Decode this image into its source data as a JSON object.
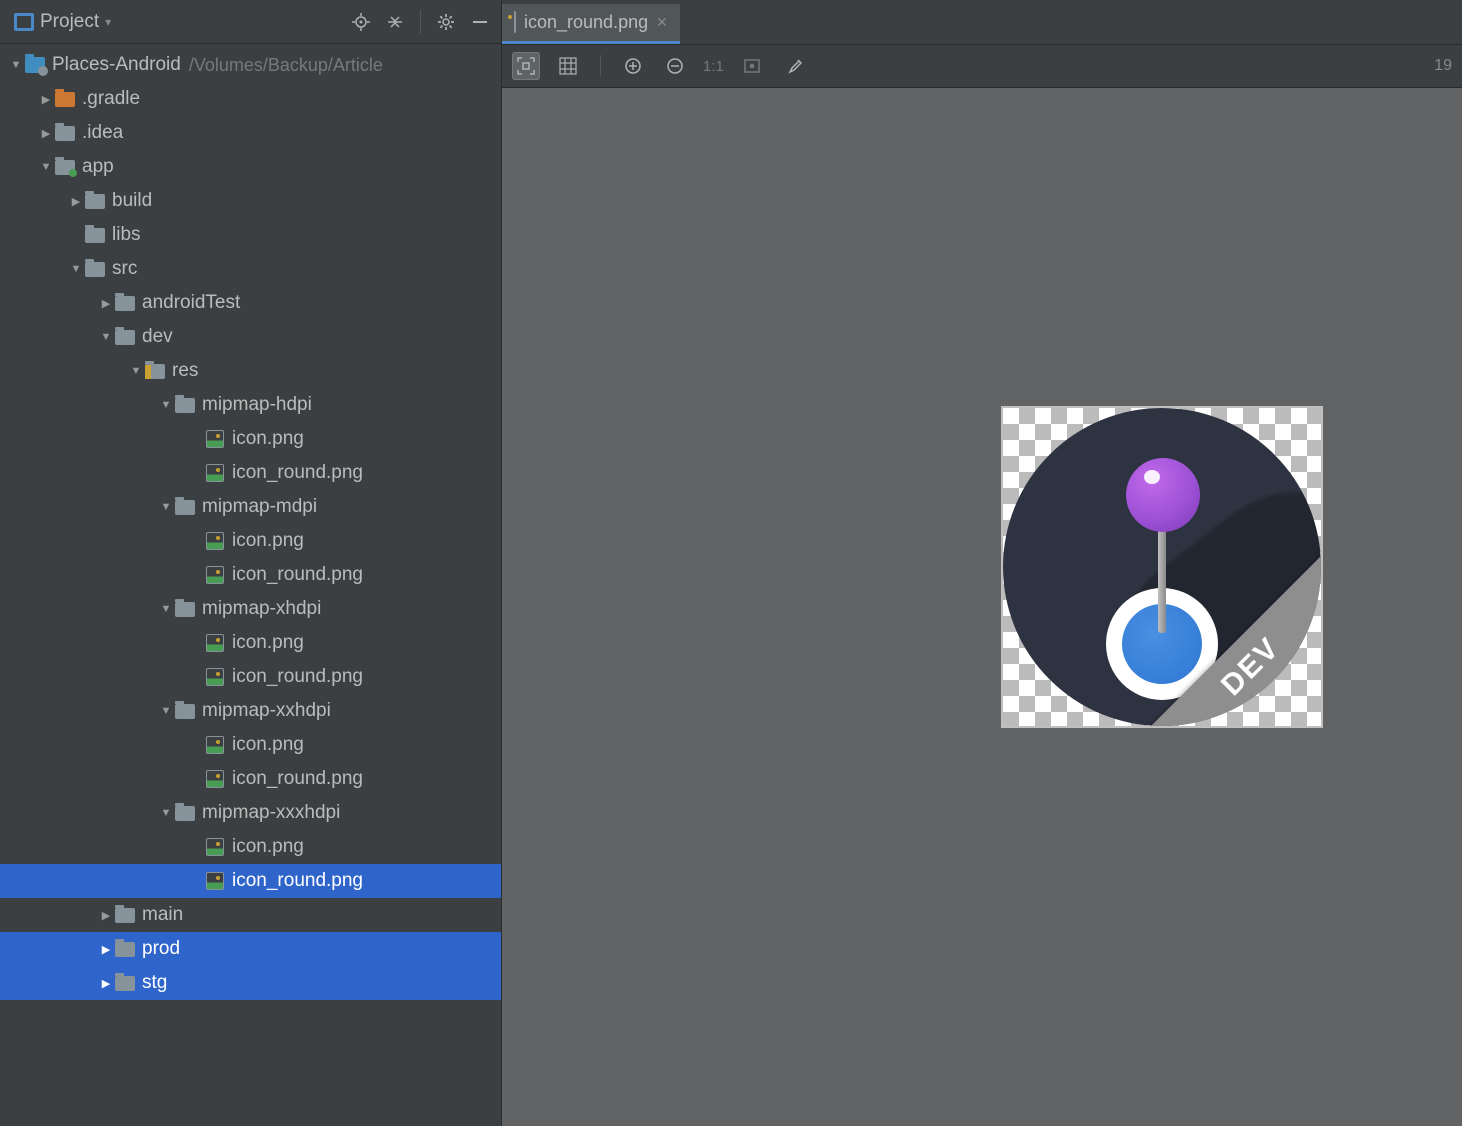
{
  "projectPanel": {
    "title": "Project",
    "rootName": "Places-Android",
    "rootPath": "/Volumes/Backup/Article"
  },
  "tree": [
    {
      "indent": 0,
      "arrow": "down",
      "icon": "proj-root",
      "label": "Places-Android",
      "pathLabel": "/Volumes/Backup/Article",
      "sel": false
    },
    {
      "indent": 1,
      "arrow": "right",
      "icon": "folder-orange",
      "label": ".gradle",
      "sel": false
    },
    {
      "indent": 1,
      "arrow": "right",
      "icon": "folder",
      "label": ".idea",
      "sel": false
    },
    {
      "indent": 1,
      "arrow": "down",
      "icon": "folder-module",
      "label": "app",
      "sel": false
    },
    {
      "indent": 2,
      "arrow": "right",
      "icon": "folder",
      "label": "build",
      "sel": false
    },
    {
      "indent": 2,
      "arrow": "none",
      "icon": "folder",
      "label": "libs",
      "sel": false
    },
    {
      "indent": 2,
      "arrow": "down",
      "icon": "folder",
      "label": "src",
      "sel": false
    },
    {
      "indent": 3,
      "arrow": "right",
      "icon": "folder",
      "label": "androidTest",
      "sel": false
    },
    {
      "indent": 3,
      "arrow": "down",
      "icon": "folder",
      "label": "dev",
      "sel": false
    },
    {
      "indent": 4,
      "arrow": "down",
      "icon": "folder-res",
      "label": "res",
      "sel": false
    },
    {
      "indent": 5,
      "arrow": "down",
      "icon": "folder",
      "label": "mipmap-hdpi",
      "sel": false
    },
    {
      "indent": 6,
      "arrow": "none",
      "icon": "file-img",
      "label": "icon.png",
      "sel": false
    },
    {
      "indent": 6,
      "arrow": "none",
      "icon": "file-img",
      "label": "icon_round.png",
      "sel": false
    },
    {
      "indent": 5,
      "arrow": "down",
      "icon": "folder",
      "label": "mipmap-mdpi",
      "sel": false
    },
    {
      "indent": 6,
      "arrow": "none",
      "icon": "file-img",
      "label": "icon.png",
      "sel": false
    },
    {
      "indent": 6,
      "arrow": "none",
      "icon": "file-img",
      "label": "icon_round.png",
      "sel": false
    },
    {
      "indent": 5,
      "arrow": "down",
      "icon": "folder",
      "label": "mipmap-xhdpi",
      "sel": false
    },
    {
      "indent": 6,
      "arrow": "none",
      "icon": "file-img",
      "label": "icon.png",
      "sel": false
    },
    {
      "indent": 6,
      "arrow": "none",
      "icon": "file-img",
      "label": "icon_round.png",
      "sel": false
    },
    {
      "indent": 5,
      "arrow": "down",
      "icon": "folder",
      "label": "mipmap-xxhdpi",
      "sel": false
    },
    {
      "indent": 6,
      "arrow": "none",
      "icon": "file-img",
      "label": "icon.png",
      "sel": false
    },
    {
      "indent": 6,
      "arrow": "none",
      "icon": "file-img",
      "label": "icon_round.png",
      "sel": false
    },
    {
      "indent": 5,
      "arrow": "down",
      "icon": "folder",
      "label": "mipmap-xxxhdpi",
      "sel": false
    },
    {
      "indent": 6,
      "arrow": "none",
      "icon": "file-img",
      "label": "icon.png",
      "sel": false
    },
    {
      "indent": 6,
      "arrow": "none",
      "icon": "file-img",
      "label": "icon_round.png",
      "sel": true
    },
    {
      "indent": 3,
      "arrow": "right",
      "icon": "folder",
      "label": "main",
      "sel": false
    },
    {
      "indent": 3,
      "arrow": "right",
      "icon": "folder",
      "label": "prod",
      "sel": "extra"
    },
    {
      "indent": 3,
      "arrow": "right",
      "icon": "folder",
      "label": "stg",
      "sel": "extra"
    }
  ],
  "editor": {
    "tabLabel": "icon_round.png",
    "zoomLabel": "1:1",
    "counterLabel": "19",
    "ribbonText": "DEV"
  }
}
